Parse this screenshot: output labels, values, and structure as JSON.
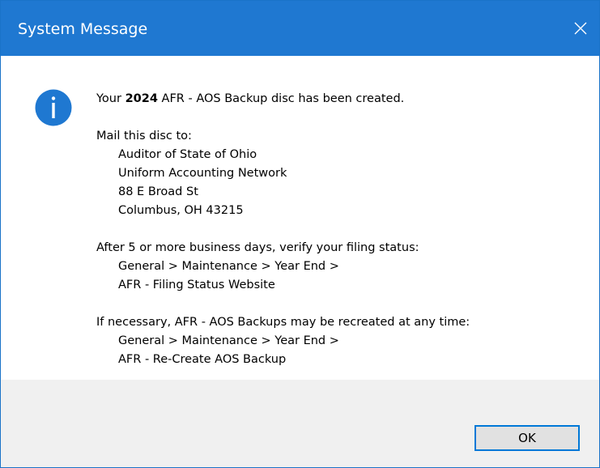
{
  "window": {
    "title": "System Message",
    "accent_color": "#1f78d1",
    "close_icon": "close-icon"
  },
  "message": {
    "icon": "info-icon",
    "line1_prefix": "Your",
    "line1_year": "2024",
    "line1_suffix": "AFR - AOS Backup disc has been created.",
    "mail_heading": "Mail this disc to:",
    "address": [
      "Auditor of State of Ohio",
      "Uniform Accounting Network",
      "88 E Broad St",
      "Columbus, OH 43215"
    ],
    "verify_heading": "After 5 or more business days, verify your filing status:",
    "verify_path": [
      "General > Maintenance > Year End >",
      "AFR - Filing Status Website"
    ],
    "recreate_heading": "If necessary, AFR - AOS Backups may be recreated at any time:",
    "recreate_path": [
      "General > Maintenance > Year End >",
      "AFR - Re-Create AOS Backup"
    ]
  },
  "buttons": {
    "ok_label": "OK"
  }
}
